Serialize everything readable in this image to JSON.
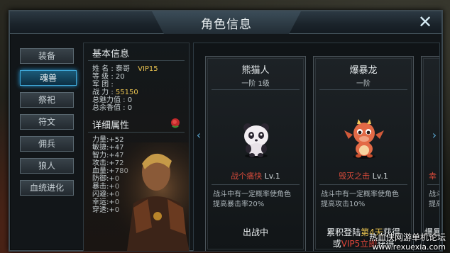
{
  "window": {
    "title": "角色信息"
  },
  "sidebar": {
    "items": [
      {
        "label": "装备",
        "active": false
      },
      {
        "label": "魂兽",
        "active": true
      },
      {
        "label": "祭祀",
        "active": false
      },
      {
        "label": "符文",
        "active": false
      },
      {
        "label": "佣兵",
        "active": false
      },
      {
        "label": "狼人",
        "active": false
      },
      {
        "label": "血统进化",
        "active": false
      }
    ]
  },
  "basic_info": {
    "heading": "基本信息",
    "name_label": "姓 名 :",
    "name_value": "泰哥",
    "vip": "VIP15",
    "level_label": "等 级 :",
    "level_value": "20",
    "legion_label": "军 团 :",
    "legion_value": "",
    "power_label": "战 力 :",
    "power_value": "55150",
    "charm_label": "总魅力值 :",
    "charm_value": "0",
    "fragrance_label": "总余香值 :",
    "fragrance_value": "0"
  },
  "detail_attrs": {
    "heading": "详细属性",
    "rows": [
      {
        "label": "力量",
        "value": ":+52"
      },
      {
        "label": "敏捷",
        "value": ":+47"
      },
      {
        "label": "智力",
        "value": ":+47"
      },
      {
        "label": "攻击",
        "value": ":+72"
      },
      {
        "label": "血量",
        "value": ":+780"
      },
      {
        "label": "防御",
        "value": ":+0"
      },
      {
        "label": "暴击",
        "value": ":+0"
      },
      {
        "label": "闪避",
        "value": ":+0"
      },
      {
        "label": "幸运",
        "value": ":+0"
      },
      {
        "label": "穿透",
        "value": ":+0"
      }
    ]
  },
  "cards": [
    {
      "name": "熊猫人",
      "rank": "一阶 1级",
      "pet_icon": "panda-pet-icon",
      "skill_name": "战个痛快",
      "skill_level": "Lv.1",
      "desc_line1": "战斗中有一定概率使角色",
      "desc_line2": "提高暴击率20%",
      "status_line1": "出战中",
      "status_pre": "",
      "status_hl": "",
      "status_mid": "",
      "status_red": "",
      "status_post": ""
    },
    {
      "name": "爆暴龙",
      "rank": "一阶",
      "pet_icon": "baby-dragon-pet-icon",
      "skill_name": "毁灭之击",
      "skill_level": "Lv.1",
      "desc_line1": "战斗中有一定概率使角色",
      "desc_line2": "提高攻击10%",
      "status_line1": "",
      "status_pre": "累积登陆",
      "status_hl": "第4天",
      "status_mid": "获得",
      "status_or": "或",
      "status_red": "VIP5立即",
      "status_post": "获得"
    },
    {
      "name": "",
      "rank": "",
      "pet_icon": "",
      "skill_name": "幸",
      "skill_level": "",
      "desc_line1": "战斗中",
      "desc_line2": "提高暴",
      "status_line1": "爆暴龙",
      "status_pre": "",
      "status_hl": "",
      "status_mid": "",
      "status_red": "",
      "status_post": ""
    }
  ],
  "watermark": {
    "line1": "热血侠网游单机论坛",
    "line2": "www.rexuexia.com"
  },
  "colors": {
    "accent": "#3fa8d8",
    "gold": "#e9c350",
    "red": "#d64a3a"
  }
}
